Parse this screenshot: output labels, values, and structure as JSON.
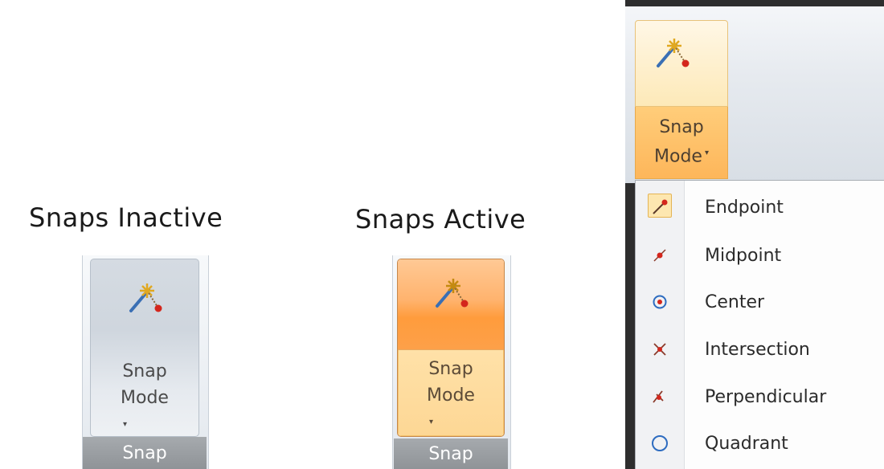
{
  "captions": {
    "inactive": "Snaps Inactive",
    "active": "Snaps Active"
  },
  "snap_button": {
    "line1": "Snap",
    "line2": "Mode",
    "caret": "▾",
    "icon": "snap-wand-icon"
  },
  "group_label": "Snap",
  "menu": {
    "items": [
      {
        "label": "Endpoint",
        "icon": "endpoint-icon",
        "checked": true
      },
      {
        "label": "Midpoint",
        "icon": "midpoint-icon",
        "checked": false
      },
      {
        "label": "Center",
        "icon": "center-icon",
        "checked": false
      },
      {
        "label": "Intersection",
        "icon": "intersection-icon",
        "checked": false
      },
      {
        "label": "Perpendicular",
        "icon": "perpendicular-icon",
        "checked": false
      },
      {
        "label": "Quadrant",
        "icon": "quadrant-icon",
        "checked": false
      }
    ]
  },
  "colors": {
    "active_orange": "#ff9c3c",
    "inactive_gray": "#cfd6de",
    "group_bar": "#8f9397"
  }
}
